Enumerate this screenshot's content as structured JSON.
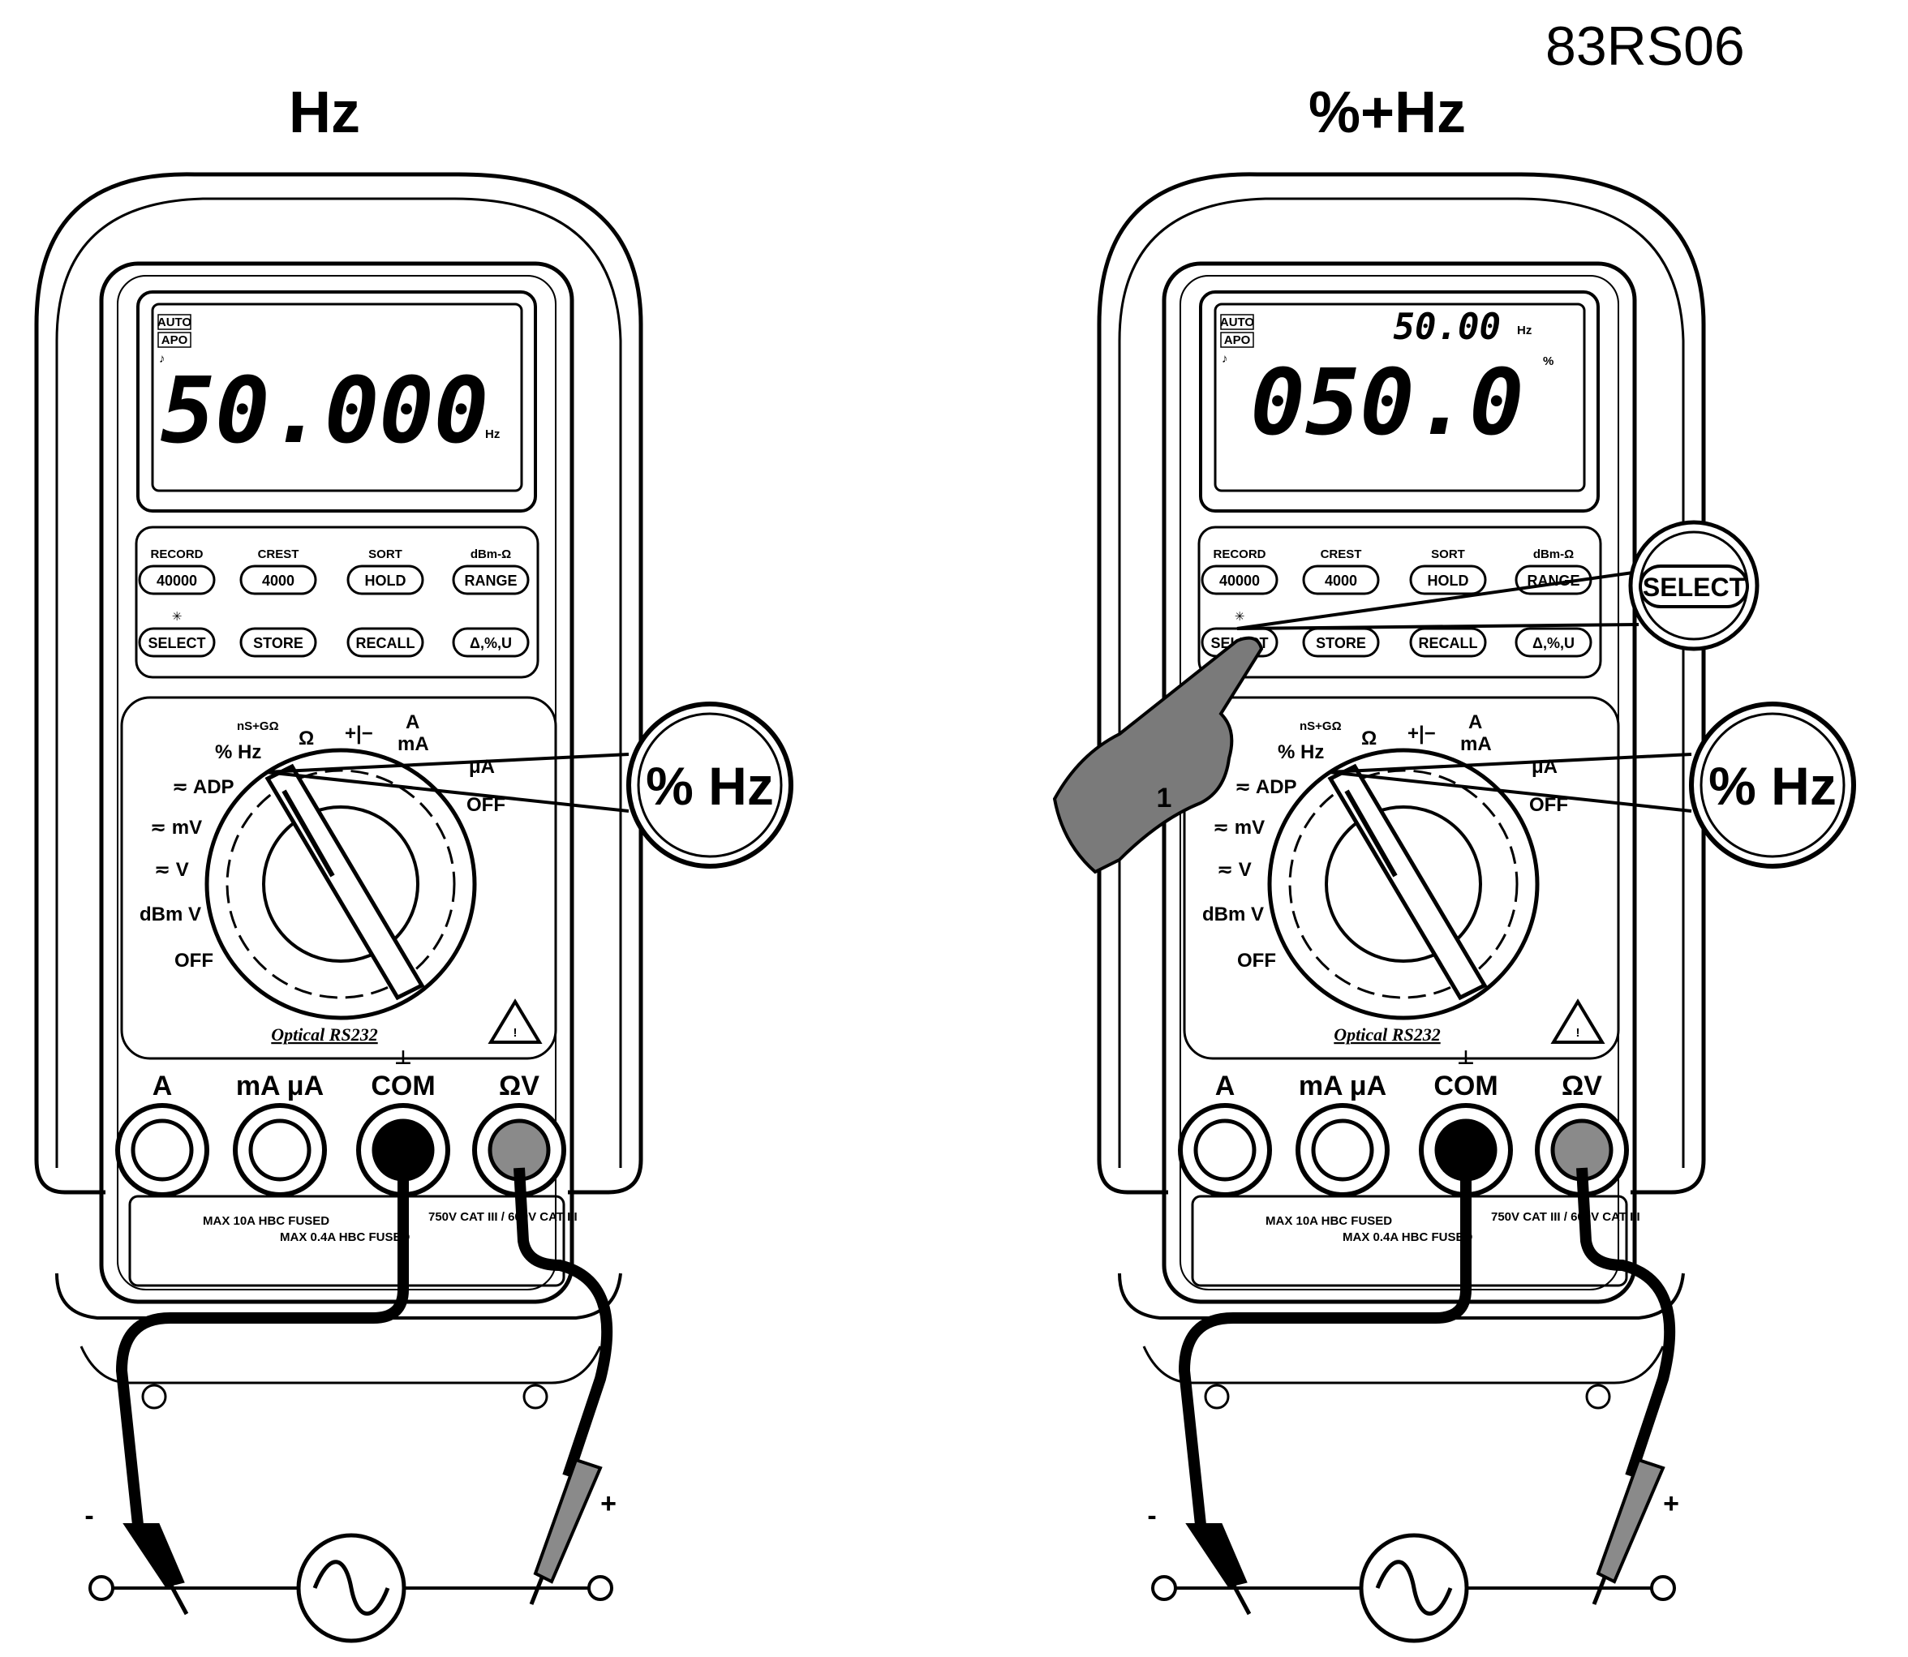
{
  "figure_id": "83RS06",
  "colors": {
    "ink": "#000000",
    "paper": "#ffffff",
    "probe_gray": "#8a8a8a",
    "hand_gray": "#7a7a7a"
  },
  "panels": [
    {
      "title": "Hz",
      "display": {
        "main": "50.000",
        "main_unit": "Hz",
        "sub": "",
        "sub_unit": "",
        "main_suffix": "",
        "flags": [
          "AUTO",
          "APO"
        ]
      },
      "callout": "% Hz",
      "show_select": false
    },
    {
      "title": "%+Hz",
      "display": {
        "main": "050.0",
        "main_unit": "",
        "sub": "50.00",
        "sub_unit": "Hz",
        "main_suffix": "%",
        "flags": [
          "AUTO",
          "APO"
        ]
      },
      "callout": "% Hz",
      "select_callout": "SELECT",
      "finger_step": "1",
      "show_select": true
    }
  ],
  "buttons_top": [
    {
      "above": "RECORD",
      "label": "40000"
    },
    {
      "above": "CREST",
      "label": "4000"
    },
    {
      "above": "SORT",
      "label": "HOLD"
    },
    {
      "above": "dBm-Ω",
      "label": "RANGE"
    }
  ],
  "buttons_bottom": [
    {
      "label": "SELECT"
    },
    {
      "label": "STORE"
    },
    {
      "label": "RECALL"
    },
    {
      "label": "Δ,%,U"
    }
  ],
  "dial_labels": {
    "adp": "ADP",
    "mv": "mV",
    "v": "V",
    "dbm": "dBm V",
    "off_left": "OFF",
    "off_right": "OFF",
    "hz": "% Hz",
    "ohm": "Ω",
    "ma": "mA",
    "a": "A",
    "ua": "μA",
    "ns": "nS+GΩ",
    "diode_cap": "+|−"
  },
  "jacks": [
    "A",
    "mA μA",
    "COM",
    "ΩV"
  ],
  "jack_notes": [
    "MAX 10A HBC FUSED",
    "MAX 0.4A HBC FUSED",
    "750V CAT III / 600V CAT III"
  ],
  "optical": "Optical RS232",
  "polarity": {
    "minus": "-",
    "plus": "+"
  }
}
